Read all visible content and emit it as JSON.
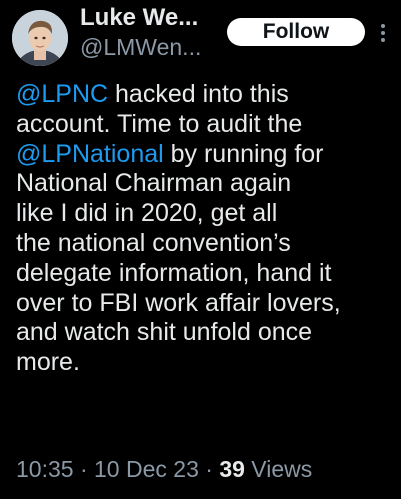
{
  "author": {
    "display_name": "Luke We...",
    "handle": "@LMWen..."
  },
  "actions": {
    "follow_label": "Follow",
    "more_icon": "more-vertical-icon"
  },
  "tweet": {
    "lines": [
      {
        "mention": "@LPNC",
        "text": " hacked into this"
      },
      {
        "text": "account.  Time to audit the"
      },
      {
        "mention": "@LPNational",
        "text": " by running for"
      },
      {
        "text": "National Chairman again"
      },
      {
        "text": "like I did in 2020, get all"
      },
      {
        "text": "the national convention’s"
      },
      {
        "text": "delegate information, hand it"
      },
      {
        "text": "over to FBI work affair lovers,"
      },
      {
        "text": "and watch shit unfold once"
      },
      {
        "text": "more."
      }
    ]
  },
  "meta": {
    "time": "10:35",
    "separator": " · ",
    "date": "10 Dec 23",
    "views_count": "39",
    "views_label": " Views"
  },
  "colors": {
    "background": "#000000",
    "text": "#e7e9ea",
    "secondary": "#8b98a5",
    "link": "#1d9bf0"
  }
}
